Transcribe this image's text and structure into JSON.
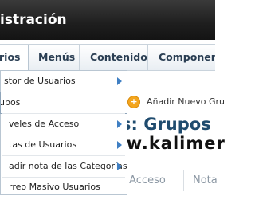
{
  "header": {
    "title": "istración"
  },
  "menubar": {
    "tabs": [
      {
        "label": "rios"
      },
      {
        "label": "Menús"
      },
      {
        "label": "Contenido"
      },
      {
        "label": "Componente"
      }
    ]
  },
  "dropdown": {
    "items": [
      {
        "label": "stor de Usuarios",
        "has_submenu": true
      },
      {
        "label": "upos",
        "has_submenu": false
      },
      {
        "label": "veles de Acceso",
        "has_submenu": true
      },
      {
        "label": "tas de Usuarios",
        "has_submenu": true
      },
      {
        "label": "adir nota de las Categorías",
        "has_submenu": true
      },
      {
        "label": "rreo Masivo Usuarios",
        "has_submenu": false
      }
    ]
  },
  "toolbar": {
    "new_group": "Añadir Nuevo Gru"
  },
  "page": {
    "title": "s: Grupos"
  },
  "watermark": "www.kalimer",
  "table": {
    "columns": [
      "e Acceso",
      "Nota"
    ]
  },
  "colors": {
    "header_bg": "#1e1e1e",
    "menu_text": "#2a3e53",
    "title": "#1f4b6e",
    "accent_orange": "#f3a51e",
    "arrow_blue": "#3f7fc3"
  },
  "icons": {
    "add": "plus-circle-icon",
    "submenu": "chevron-right-icon"
  }
}
